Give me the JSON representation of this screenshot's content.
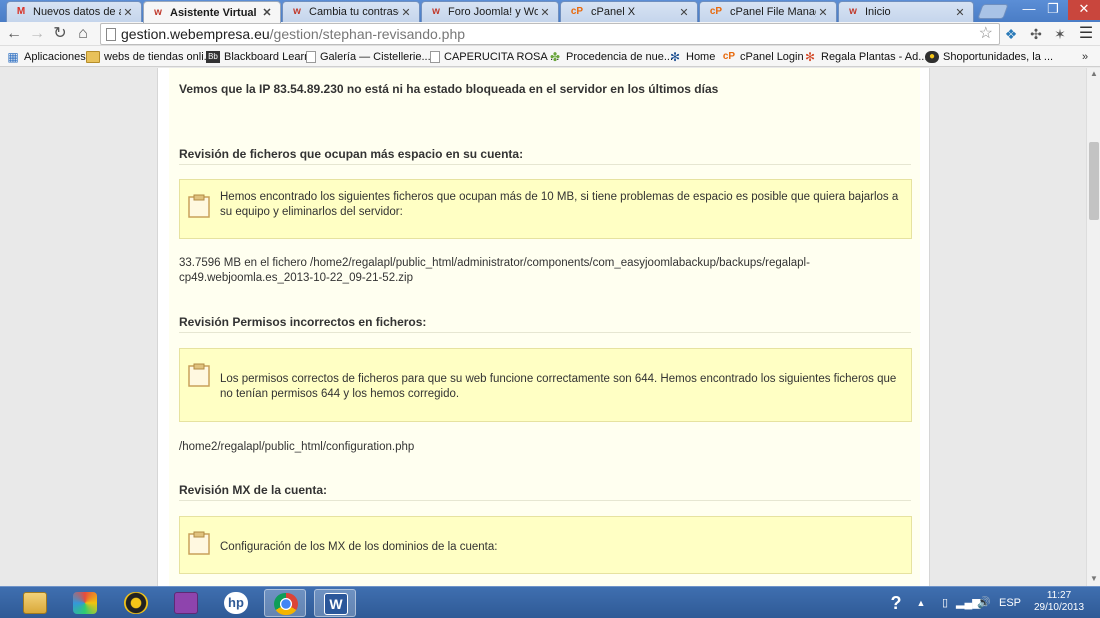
{
  "browser": {
    "tabs": [
      {
        "title": "Nuevos datos de acce",
        "icon": "gmail-icon",
        "icon_text": "M",
        "icon_color": "#d93025"
      },
      {
        "title": "Asistente Virtual Steph",
        "icon": "webempresa-icon",
        "icon_text": "w",
        "icon_color": "#c0392b"
      },
      {
        "title": "Cambia tu contraseña",
        "icon": "webempresa-icon",
        "icon_text": "w",
        "icon_color": "#c0392b"
      },
      {
        "title": "Foro Joomla! y WordP",
        "icon": "webempresa-icon",
        "icon_text": "w",
        "icon_color": "#c0392b"
      },
      {
        "title": "cPanel X",
        "icon": "cpanel-icon",
        "icon_text": "cP",
        "icon_color": "#e8690c"
      },
      {
        "title": "cPanel File Manager v",
        "icon": "cpanel-icon",
        "icon_text": "cP",
        "icon_color": "#e8690c"
      },
      {
        "title": "Inicio",
        "icon": "webempresa-icon",
        "icon_text": "w",
        "icon_color": "#c0392b"
      }
    ],
    "active_tab": 1,
    "url_host": "gestion.webempresa.eu",
    "url_path": "/gestion/stephan-revisando.php",
    "bookmarks": [
      {
        "label": "Aplicaciones",
        "icon": "apps-grid-icon"
      },
      {
        "label": "webs de tiendas onli...",
        "icon": "folder-icon"
      },
      {
        "label": "Blackboard Learn",
        "icon": "blackboard-icon"
      },
      {
        "label": "Galería — Cistellerie...",
        "icon": "document-icon"
      },
      {
        "label": "CAPERUCITA ROSA ...",
        "icon": "document-icon"
      },
      {
        "label": "Procedencia de nue...",
        "icon": "puzzle-icon"
      },
      {
        "label": "Home",
        "icon": "joomla-icon"
      },
      {
        "label": "cPanel Login",
        "icon": "cpanel-icon"
      },
      {
        "label": "Regala Plantas - Ad...",
        "icon": "joomla-icon"
      },
      {
        "label": "Shoportunidades, la ...",
        "icon": "shop-icon"
      }
    ]
  },
  "page": {
    "ip_status": "Vemos que la IP 83.54.89.230 no está ni ha estado bloqueada en el servidor en los últimos días",
    "sections": [
      {
        "heading": "Revisión de ficheros que ocupan más espacio en su cuenta:",
        "notice": "Hemos encontrado los siguientes ficheros que ocupan más de 10 MB, si tiene problemas de espacio es posible que quiera bajarlos a su equipo y eliminarlos del servidor:",
        "detail": "33.7596 MB en el fichero /home2/regalapl/public_html/administrator/components/com_easyjoomlabackup/backups/regalapl-cp49.webjoomla.es_2013-10-22_09-21-52.zip"
      },
      {
        "heading": "Revisión Permisos incorrectos en ficheros:",
        "notice": "Los permisos correctos de ficheros para que su web funcione correctamente son 644. Hemos encontrado los siguientes ficheros que no tenían permisos 644 y los hemos corregido.",
        "detail": "/home2/regalapl/public_html/configuration.php"
      },
      {
        "heading": "Revisión MX de la cuenta:",
        "notice": "Configuración de los MX de los dominios de la cuenta:"
      }
    ]
  },
  "taskbar": {
    "language": "ESP",
    "time": "11:27",
    "date": "29/10/2013"
  }
}
